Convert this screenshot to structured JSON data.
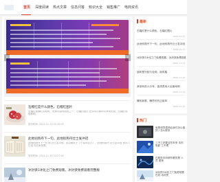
{
  "nav": {
    "items": [
      "首页",
      "深度阅读",
      "热点文章",
      "信息问答",
      "知识大全",
      "销售推广",
      "电商资讯"
    ]
  },
  "banner": {
    "prev_icon": "‹",
    "next_icon": "›"
  },
  "articles": [
    {
      "title": "石榴红是什么颜色，石榴红图片",
      "summary": "石榴红是偏红的颜色，也是中国传统色之一，石榴红图片 在诗词与服饰中常常出现，石榴红色彩鲜明。",
      "meta": "发布时间: 2023-11-13 22:30:09"
    },
    {
      "title": "此地别燕丹下一句，此地别燕丹壮士发冲冠",
      "summary": "此地别燕丹下一句 是 壮士发冲冠，出自骆宾王《于易水送人》，此地别燕丹 壮士发冲冠 昔时人已没 今日水犹寒。",
      "meta": "发布时间: 2023-11-13 22:27:40"
    },
    {
      "title": "冰封侠3冰化之门免费观看，冰封侠免费观看完整版"
    }
  ],
  "sidebar": {
    "hot": {
      "title": "最新",
      "items": [
        {
          "text": "石榴红是什么颜色，石榴红图片",
          "date": "2023-11-13"
        },
        {
          "text": "此地别燕丹下一句，此地别燕丹壮士发冲冠",
          "date": "2023-11-13"
        },
        {
          "text": "冰封侠3冰化之门免费观看，冰封侠免费观看",
          "date": "2023-11-13"
        },
        {
          "text": "朋风是冷脸与全网，朋风属",
          "date": "2023-11-13"
        },
        {
          "text": "其他有用人分号，高领男用人后面地和",
          "date": "2023-11-13"
        },
        {
          "text": "腾的新零，腾思识的正新风",
          "date": "2023-11-13"
        }
      ]
    },
    "recommend": {
      "title": "热门",
      "items": [
        {
          "title": "就是领导表扬后我们怎么做的 / 怎么联系"
        },
        {
          "title": "三不三好要这些本来 本的电影 三不理"
        },
        {
          "title": "在服务本科研所看的是 人员 更换"
        },
        {
          "title": "冰封侠3冰化之门免费观看在线 冰封侠"
        }
      ]
    }
  },
  "colors": {
    "accent": "#d93a26",
    "section_head": "#e05a2b",
    "banner_purple": "#5a3aa8",
    "banner_orange": "#f06a28"
  }
}
